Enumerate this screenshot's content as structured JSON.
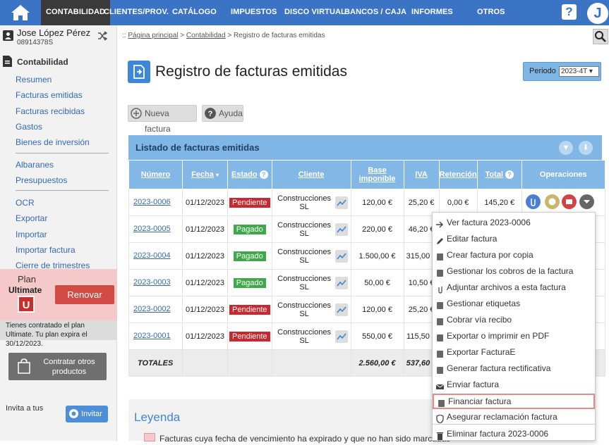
{
  "nav": {
    "items": [
      "CONTABILIDAD",
      "CLIENTES/PROV.",
      "CATÁLOGO",
      "IMPUESTOS",
      "DISCO VIRTUAL",
      "BANCOS / CAJA",
      "INFORMES",
      "OTROS"
    ],
    "help": "?",
    "avatar_letter": "J",
    "colors": {
      "bar": "#3b74c5",
      "active": "#3a3a3a"
    }
  },
  "user": {
    "name": "Jose López Pérez",
    "nif": "08914378S"
  },
  "sidebar": {
    "section": "Contabilidad",
    "links": [
      "Resumen",
      "Facturas emitidas",
      "Facturas recibidas",
      "Gastos",
      "Bienes de inversión",
      "Albaranes",
      "Presupuestos",
      "OCR",
      "Exportar",
      "Importar",
      "Importar factura",
      "Cierre de trimestres"
    ],
    "plan": {
      "word": "Plan",
      "name": "Ultimate",
      "logo": "U",
      "renew": "Renovar",
      "info": "Tienes contratado el plan Ultimate. Tu plan expira el 30/12/2023."
    },
    "contract": "Contratar otros productos",
    "invite_text": "Invita a tus",
    "invite_btn": "Invitar"
  },
  "breadcrumb": {
    "prefix": "::",
    "home": "Página principal",
    "sep": ">",
    "section": "Contabilidad",
    "current": "Registro de facturas emitidas"
  },
  "page": {
    "title": "Registro de facturas emitidas",
    "period_label": "Periodo",
    "period_value": "2023-4T ▾",
    "new_invoice": "Nueva factura",
    "help": "Ayuda"
  },
  "list": {
    "title": "Listado de facturas emitidas",
    "headers": [
      "Número",
      "Fecha",
      "Estado",
      "Cliente",
      "Base imponible",
      "IVA",
      "Retención",
      "Total",
      "Operaciones"
    ],
    "rows": [
      {
        "num": "2023-0006",
        "date": "01/12/2023",
        "status": "Pendiente",
        "client": "Construcciones SL",
        "base": "120,00 €",
        "iva": "25,20 €",
        "ret": "0,00 €",
        "total": "145,20 €"
      },
      {
        "num": "2023-0005",
        "date": "01/12/2023",
        "status": "Pagado",
        "client": "Construcciones SL",
        "base": "220,00 €",
        "iva": "46,20 €",
        "ret": "",
        "total": ""
      },
      {
        "num": "2023-0004",
        "date": "01/12/2023",
        "status": "Pagado",
        "client": "Construcciones SL",
        "base": "1.500,00 €",
        "iva": "315,00 €",
        "ret": "",
        "total": ""
      },
      {
        "num": "2023-0003",
        "date": "01/12/2023",
        "status": "Pagado",
        "client": "Construcciones SL",
        "base": "50,00 €",
        "iva": "10,50 €",
        "ret": "",
        "total": ""
      },
      {
        "num": "2023-0002",
        "date": "01/12/2023",
        "status": "Pendiente",
        "client": "Construcciones SL",
        "base": "120,00 €",
        "iva": "25,20 €",
        "ret": "",
        "total": ""
      },
      {
        "num": "2023-0001",
        "date": "01/12/2023",
        "status": "Pendiente",
        "client": "Construcciones SL",
        "base": "550,00 €",
        "iva": "115,50 €",
        "ret": "",
        "total": ""
      }
    ],
    "totals": {
      "label": "TOTALES",
      "base": "2.560,00 €",
      "iva": "537,60 €"
    },
    "status_colors": {
      "Pendiente": "#c8282e",
      "Pagado": "#3ea84a"
    }
  },
  "menu": {
    "items": [
      "Ver factura 2023-0006",
      "Editar factura",
      "Crear factura por copia",
      "Gestionar los cobros de la factura",
      "Adjuntar archivos a esta factura",
      "Gestionar etiquetas",
      "Cobrar vía recibo",
      "Exportar o imprimir en PDF",
      "Exportar FacturaE",
      "Generar factura rectificativa",
      "Enviar factura",
      "Financiar factura",
      "Asegurar reclamación factura",
      "Eliminar factura 2023-0006"
    ],
    "icons": [
      "arrow-right-icon",
      "pencil-icon",
      "copy-icon",
      "payments-icon",
      "paperclip-icon",
      "tag-icon",
      "bank-icon",
      "print-icon",
      "export-icon",
      "document-icon",
      "envelope-icon",
      "file-icon",
      "shield-icon",
      "trash-icon"
    ],
    "highlighted": "Financiar factura"
  },
  "legend": {
    "title": "Leyenda",
    "text": "Facturas cuya fecha de vencimiento ha expirado y que no han sido marcadas"
  }
}
